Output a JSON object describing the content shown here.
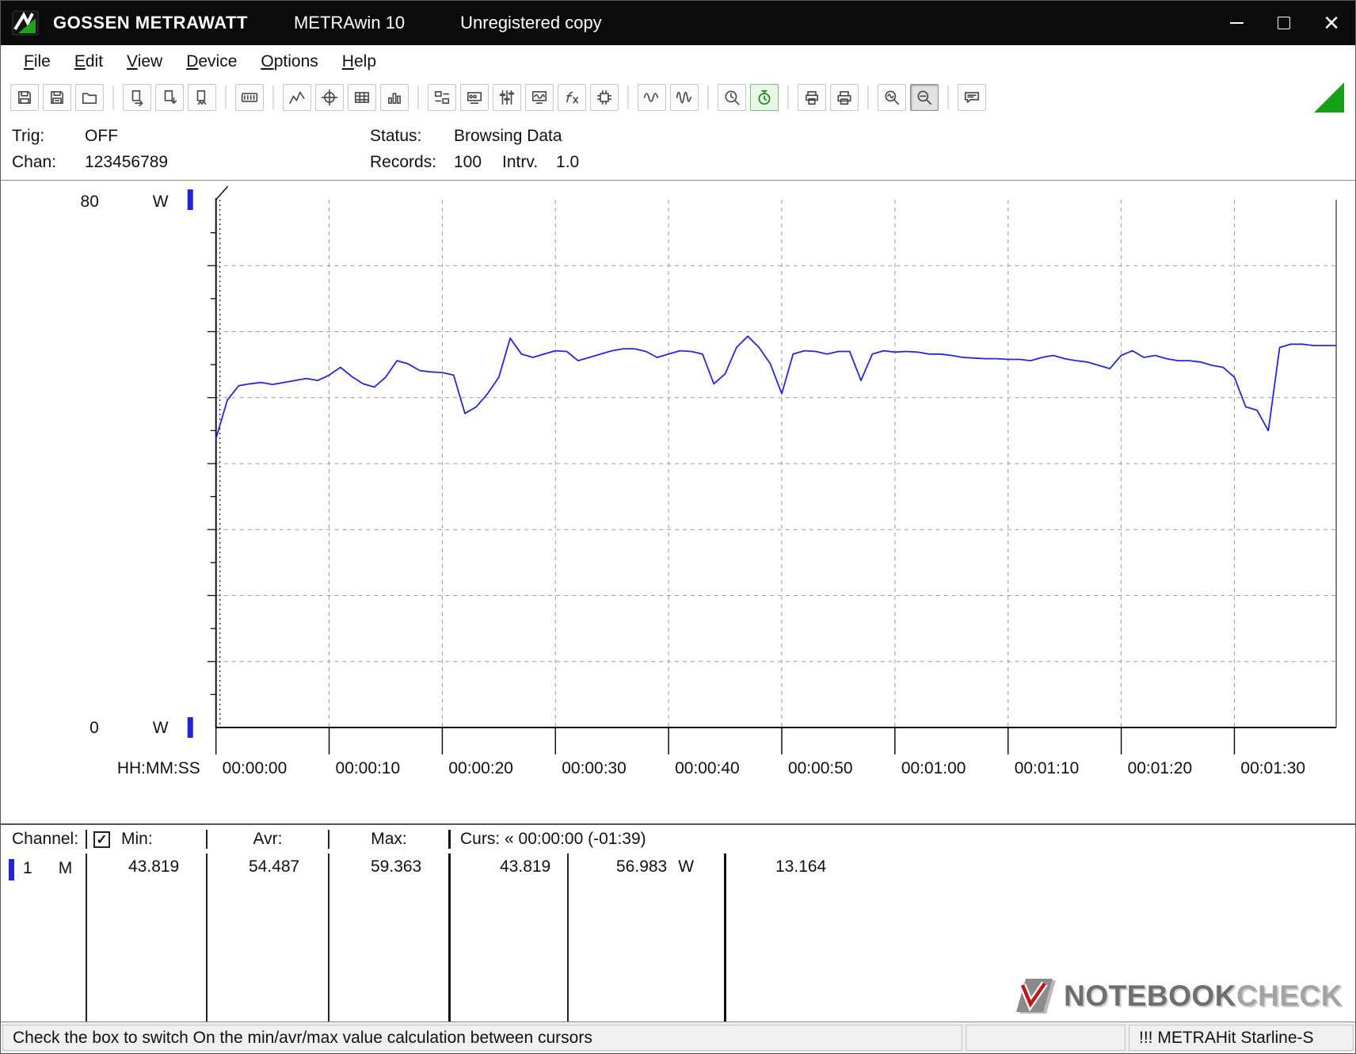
{
  "window": {
    "brand": "GOSSEN METRAWATT",
    "app": "METRAwin 10",
    "license": "Unregistered copy",
    "controls": {
      "close_glyph": "×"
    }
  },
  "menu": {
    "items": [
      {
        "label": "File"
      },
      {
        "label": "Edit"
      },
      {
        "label": "View"
      },
      {
        "label": "Device"
      },
      {
        "label": "Options"
      },
      {
        "label": "Help"
      }
    ]
  },
  "toolbar": {
    "buttons": [
      {
        "name": "save",
        "icon": "floppy"
      },
      {
        "name": "save-all",
        "icon": "floppy2"
      },
      {
        "name": "open",
        "icon": "folder"
      },
      {
        "sep": true
      },
      {
        "name": "export-text",
        "icon": "docarrow"
      },
      {
        "name": "export-table",
        "icon": "docarrow2"
      },
      {
        "name": "export-meter",
        "icon": "docarrow3"
      },
      {
        "sep": true
      },
      {
        "name": "lcd-display",
        "icon": "lcd"
      },
      {
        "sep": true
      },
      {
        "name": "graph-view",
        "icon": "linechart"
      },
      {
        "name": "crosshair-cursor",
        "icon": "crosshair"
      },
      {
        "name": "table-view",
        "icon": "grid"
      },
      {
        "name": "histogram-view",
        "icon": "bars"
      },
      {
        "sep": true
      },
      {
        "name": "data-transfer",
        "icon": "transfer"
      },
      {
        "name": "device-settings",
        "icon": "device"
      },
      {
        "name": "channel-settings",
        "icon": "sliders"
      },
      {
        "name": "monitor-display",
        "icon": "screenwave"
      },
      {
        "name": "function-fx",
        "icon": "fx"
      },
      {
        "name": "memory-read",
        "icon": "chip"
      },
      {
        "sep": true
      },
      {
        "name": "waveform-small",
        "icon": "wave1"
      },
      {
        "name": "waveform-large",
        "icon": "wave2"
      },
      {
        "sep": true
      },
      {
        "name": "time-zoom",
        "icon": "clockzoom"
      },
      {
        "name": "timer",
        "icon": "stopwatch",
        "state": "green"
      },
      {
        "sep": true
      },
      {
        "name": "print-preview",
        "icon": "printpreview"
      },
      {
        "name": "print",
        "icon": "printer"
      },
      {
        "sep": true
      },
      {
        "name": "zoom-horizontal",
        "icon": "zoomwave"
      },
      {
        "name": "zoom-cursor",
        "icon": "zoomwave2",
        "state": "pressed"
      },
      {
        "sep": true
      },
      {
        "name": "tooltip-help",
        "icon": "bubble"
      }
    ]
  },
  "info": {
    "trig_label": "Trig:",
    "trig_value": "OFF",
    "chan_label": "Chan:",
    "chan_value": "123456789",
    "status_label": "Status:",
    "status_value": "Browsing Data",
    "records_label": "Records:",
    "records_value": "100",
    "intrv_label": "Intrv.",
    "intrv_value": "1.0"
  },
  "chart_data": {
    "type": "line",
    "title": "Power measurement over time",
    "unit": "W",
    "y_max_label": "80",
    "y_min_label": "0",
    "x_axis_label": "HH:MM:SS",
    "ylim": [
      0,
      80
    ],
    "x_domain_seconds": [
      0,
      99
    ],
    "interval_seconds": 1,
    "grid": "dashed",
    "x_ticks": [
      "00:00:00",
      "00:00:10",
      "00:00:20",
      "00:00:30",
      "00:00:40",
      "00:00:50",
      "00:01:00",
      "00:01:10",
      "00:01:20",
      "00:01:30"
    ],
    "cursor1_time_seconds": 0,
    "series": [
      {
        "name": "Channel 1",
        "color": "#2626d8",
        "unit": "W",
        "min": 43.819,
        "avr": 54.487,
        "max": 59.363,
        "values": [
          43.8,
          49.6,
          51.8,
          52.1,
          52.3,
          52.0,
          52.3,
          52.6,
          52.9,
          52.6,
          53.4,
          54.6,
          53.2,
          52.1,
          51.6,
          53.1,
          55.6,
          55.1,
          54.1,
          53.9,
          53.8,
          53.4,
          47.6,
          48.6,
          50.6,
          53.1,
          59.0,
          56.6,
          56.1,
          56.6,
          57.1,
          57.0,
          55.6,
          56.1,
          56.6,
          57.1,
          57.4,
          57.4,
          57.0,
          56.1,
          56.6,
          57.1,
          57.0,
          56.6,
          52.1,
          53.6,
          57.6,
          59.3,
          57.6,
          55.1,
          50.6,
          56.6,
          57.1,
          57.0,
          56.6,
          57.0,
          57.0,
          52.6,
          56.6,
          57.1,
          56.9,
          57.0,
          56.9,
          56.6,
          56.6,
          56.4,
          56.1,
          56.0,
          55.9,
          55.9,
          55.8,
          55.8,
          55.6,
          56.1,
          56.4,
          55.9,
          55.6,
          55.4,
          54.9,
          54.4,
          56.4,
          57.1,
          56.1,
          56.4,
          55.9,
          55.6,
          55.6,
          55.4,
          54.9,
          54.6,
          53.1,
          48.6,
          48.1,
          45.0,
          57.6,
          58.1,
          58.1,
          57.9,
          57.9,
          57.9
        ]
      }
    ]
  },
  "table": {
    "header": {
      "channel": "Channel:",
      "min": "Min:",
      "avr": "Avr:",
      "max": "Max:",
      "curs": "Curs: « 00:00:00 (-01:39)"
    },
    "checkbox_glyph": "✓",
    "row": {
      "channel": "1",
      "mode": "M",
      "min": "43.819",
      "avr": "54.487",
      "max": "59.363",
      "curs_a": "43.819",
      "curs_b": "56.983",
      "curs_b_unit": "W",
      "delta": "13.164"
    }
  },
  "statusbar": {
    "message": "Check the box to switch On the min/avr/max value calculation between cursors",
    "device": "!!! METRAHit Starline-S"
  },
  "watermark": {
    "bold": "NOTEBOOK",
    "light": "CHECK"
  }
}
